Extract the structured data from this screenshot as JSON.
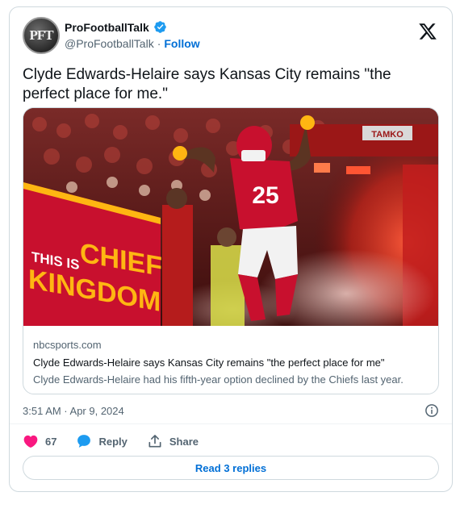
{
  "account": {
    "avatar_text": "PFT",
    "display_name": "ProFootballTalk",
    "handle": "@ProFootballTalk",
    "separator": "·",
    "follow_label": "Follow"
  },
  "tweet": {
    "text": "Clyde Edwards-Helaire says Kansas City remains \"the perfect place for me.\"",
    "timestamp": "3:51 AM · Apr 9, 2024"
  },
  "link_card": {
    "domain": "nbcsports.com",
    "title": "Clyde Edwards-Helaire says Kansas City remains \"the perfect place for me\"",
    "description": "Clyde Edwards-Helaire had his fifth-year option declined by the Chiefs last year.",
    "image": {
      "banner_line1": "THIS IS",
      "banner_word1": "CHIEFS",
      "banner_word2": "KINGDOM",
      "jersey_number": "25",
      "sign": "TAMKO"
    }
  },
  "actions": {
    "like_count": "67",
    "reply_label": "Reply",
    "share_label": "Share",
    "read_replies_label": "Read 3 replies"
  },
  "colors": {
    "brand_blue": "#006fd6",
    "verified_blue": "#1d9bf0",
    "like_pink": "#f91880",
    "chiefs_red": "#c8102e",
    "chiefs_gold": "#ffb612"
  },
  "icons": [
    "verified-badge-icon",
    "x-logo-icon",
    "info-icon",
    "heart-icon",
    "reply-bubble-icon",
    "share-icon"
  ]
}
